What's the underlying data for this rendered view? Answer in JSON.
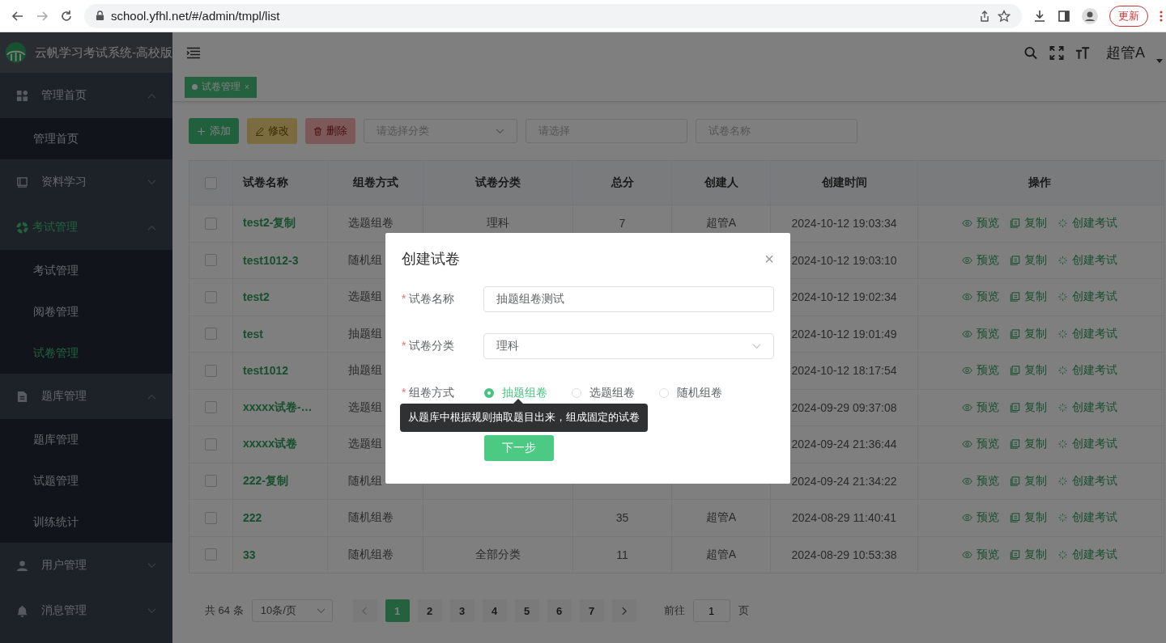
{
  "browser": {
    "url": "school.yfhl.net/#/admin/tmpl/list",
    "update_button": "更新"
  },
  "app": {
    "title": "云帆学习考试系统-高校版",
    "user": "超管A"
  },
  "sidebar": {
    "groups": [
      {
        "label": "管理首页",
        "expanded": true,
        "active": false,
        "children": [
          {
            "label": "管理首页",
            "selected": false
          }
        ]
      },
      {
        "label": "资料学习",
        "expanded": false,
        "active": false
      },
      {
        "label": "考试管理",
        "expanded": true,
        "active": true,
        "children": [
          {
            "label": "考试管理",
            "selected": false
          },
          {
            "label": "阅卷管理",
            "selected": false
          },
          {
            "label": "试卷管理",
            "selected": true
          }
        ]
      },
      {
        "label": "题库管理",
        "expanded": true,
        "active": false,
        "children": [
          {
            "label": "题库管理",
            "selected": false
          },
          {
            "label": "试题管理",
            "selected": false
          },
          {
            "label": "训练统计",
            "selected": false
          }
        ]
      },
      {
        "label": "用户管理",
        "expanded": false,
        "active": false
      },
      {
        "label": "消息管理",
        "expanded": false,
        "active": false
      }
    ]
  },
  "tabs": [
    {
      "label": "试卷管理",
      "selected": true,
      "close": "×"
    }
  ],
  "toolbar": {
    "buttons": [
      {
        "label": "添加",
        "kind": "add",
        "disabled": false
      },
      {
        "label": "修改",
        "kind": "edit",
        "disabled": true
      },
      {
        "label": "删除",
        "kind": "delete",
        "disabled": true
      }
    ],
    "filters": [
      {
        "placeholder": "请选择分类",
        "kind": "select"
      },
      {
        "placeholder": "请选择",
        "kind": "input"
      },
      {
        "placeholder": "试卷名称",
        "kind": "input"
      }
    ]
  },
  "table": {
    "header_checked": false,
    "columns": [
      "试卷名称",
      "组卷方式",
      "试卷分类",
      "总分",
      "创建人",
      "创建时间",
      "操作"
    ],
    "rows": [
      {
        "checked": false,
        "name": "test2-复制",
        "method": "选题组卷",
        "category": "理科",
        "total": "7",
        "creator": "超管A",
        "time": "2024-10-12 19:03:34",
        "actions": [
          "预览",
          "复制",
          "创建考试"
        ]
      },
      {
        "checked": false,
        "name": "test1012-3",
        "method": "随机组",
        "time": "2024-10-12 19:03:10",
        "actions": [
          "预览",
          "复制",
          "创建考试"
        ]
      },
      {
        "checked": false,
        "name": "test2",
        "method": "选题组",
        "time": "2024-10-12 19:02:34",
        "actions": [
          "预览",
          "复制",
          "创建考试"
        ]
      },
      {
        "checked": false,
        "name": "test",
        "method": "抽题组",
        "time": "2024-10-12 19:01:49",
        "actions": [
          "预览",
          "复制",
          "创建考试"
        ]
      },
      {
        "checked": false,
        "name": "test1012",
        "method": "抽题组",
        "time": "2024-10-12 18:17:54",
        "actions": [
          "预览",
          "复制",
          "创建考试"
        ]
      },
      {
        "checked": false,
        "name": "xxxxx试卷-…",
        "method": "选题组",
        "time": "2024-09-29 09:37:08",
        "actions": [
          "预览",
          "复制",
          "创建考试"
        ]
      },
      {
        "checked": false,
        "name": "xxxxx试卷",
        "method": "选题组",
        "time": "2024-09-24 21:36:44",
        "actions": [
          "预览",
          "复制",
          "创建考试"
        ]
      },
      {
        "checked": false,
        "name": "222-复制",
        "method": "随机组",
        "time": "2024-09-24 21:34:22",
        "actions": [
          "预览",
          "复制",
          "创建考试"
        ]
      },
      {
        "checked": false,
        "name": "222",
        "method": "随机组卷",
        "total": "35",
        "creator": "超管A",
        "time": "2024-08-29 11:40:41",
        "actions": [
          "预览",
          "复制",
          "创建考试"
        ]
      },
      {
        "checked": false,
        "name": "33",
        "method": "随机组卷",
        "category": "全部分类",
        "total": "11",
        "creator": "超管A",
        "time": "2024-08-29 10:53:38",
        "actions": [
          "预览",
          "复制",
          "创建考试"
        ]
      }
    ]
  },
  "pagination": {
    "total": "共 64 条",
    "page_size": "10条/页",
    "pages": [
      {
        "label": "1",
        "selected": true
      },
      {
        "label": "2",
        "selected": false
      },
      {
        "label": "3",
        "selected": false
      },
      {
        "label": "4",
        "selected": false
      },
      {
        "label": "5",
        "selected": false
      },
      {
        "label": "6",
        "selected": false
      },
      {
        "label": "7",
        "selected": false
      }
    ],
    "goto_label": "前往",
    "goto_value": "1",
    "goto_suffix": "页"
  },
  "dialog": {
    "title": "创建试卷",
    "close": "×",
    "fields": [
      {
        "label": "试卷名称",
        "required_mark": "*",
        "kind": "input",
        "value": "抽题组卷测试"
      },
      {
        "label": "试卷分类",
        "required_mark": "*",
        "kind": "select",
        "value": "理科"
      },
      {
        "label": "组卷方式",
        "required_mark": "*",
        "kind": "radio",
        "options": [
          {
            "label": "抽题组卷",
            "selected": true
          },
          {
            "label": "选题组卷",
            "selected": false
          },
          {
            "label": "随机组卷",
            "selected": false
          }
        ]
      }
    ],
    "tooltip": "从题库中根据规则抽取题目出来，组成固定的试卷",
    "submit": "下一步"
  }
}
